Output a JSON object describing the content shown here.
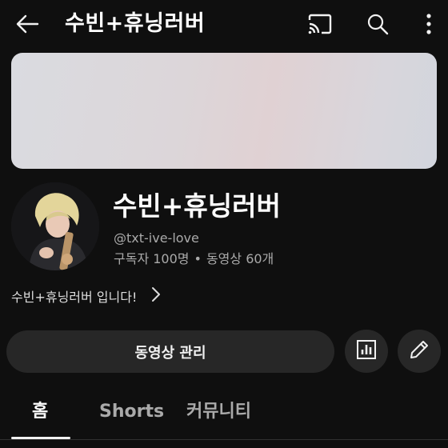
{
  "header": {
    "title": "수빈+휴닝러버",
    "icons": [
      "back-arrow-icon",
      "cast-icon",
      "search-icon",
      "more-vert-icon"
    ]
  },
  "channel": {
    "name": "수빈+휴닝러버",
    "handle": "@txt-ive-love",
    "subscribers": "구독자 100명",
    "separator": "•",
    "videos": "동영상 60개",
    "description": "수빈+휴닝러버 입니다!"
  },
  "actions": {
    "manage_label": "동영상 관리",
    "stats_icon": "analytics-icon",
    "edit_icon": "pencil-icon"
  },
  "tabs": [
    {
      "label": "홈",
      "active": true
    },
    {
      "label": "Shorts",
      "active": false
    },
    {
      "label": "커뮤니티",
      "active": false
    }
  ],
  "colors": {
    "background": "#0f0f0f",
    "button_bg": "#272727",
    "secondary_text": "#aaaaaa"
  }
}
